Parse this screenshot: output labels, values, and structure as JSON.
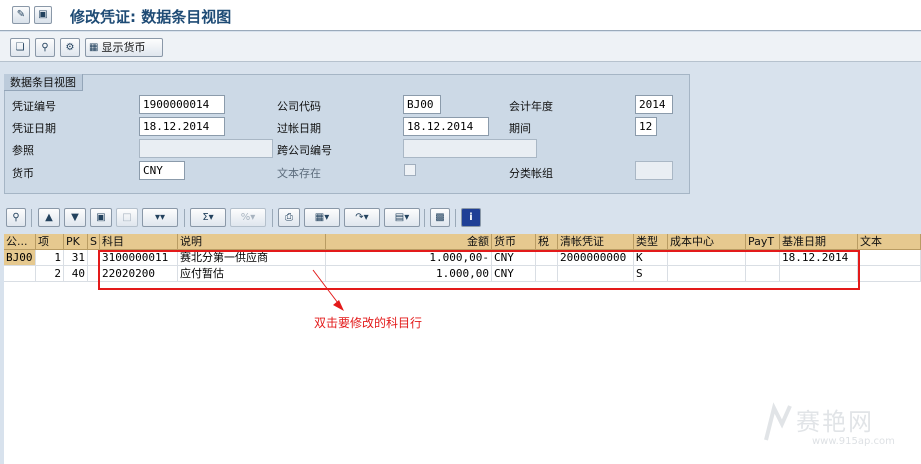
{
  "window": {
    "title": "修改凭证: 数据条目视图",
    "title_buttons": [
      "display-change-icon",
      "save-icon"
    ]
  },
  "app_toolbar": {
    "buttons": [
      "other-document-icon",
      "search-icon",
      "settings-icon"
    ],
    "display_currency_label": "显示货币"
  },
  "header": {
    "group_title": "数据条目视图",
    "fields": {
      "document_number": {
        "label": "凭证编号",
        "value": "1900000014"
      },
      "company_code": {
        "label": "公司代码",
        "value": "BJ00"
      },
      "fiscal_year": {
        "label": "会计年度",
        "value": "2014"
      },
      "document_date": {
        "label": "凭证日期",
        "value": "18.12.2014"
      },
      "posting_date": {
        "label": "过帐日期",
        "value": "18.12.2014"
      },
      "period": {
        "label": "期间",
        "value": "12"
      },
      "reference": {
        "label": "参照",
        "value": ""
      },
      "cross_company": {
        "label": "跨公司编号",
        "value": ""
      },
      "currency": {
        "label": "货币",
        "value": "CNY"
      },
      "text_exists": {
        "label": "文本存在",
        "checked": false
      },
      "ledger_group": {
        "label": "分类帐组",
        "value": ""
      }
    }
  },
  "grid_toolbar": {
    "icons": [
      "details-icon",
      "up-icon",
      "filter-icon",
      "find-icon",
      "select-icon",
      "funnel-icon",
      "sum-icon",
      "subtotal-icon",
      "percent-icon",
      "print-icon",
      "view-icon",
      "export-icon",
      "layout-icon",
      "graphic-icon",
      "info-icon"
    ]
  },
  "table": {
    "columns": [
      "公...",
      "项",
      "PK",
      "S",
      "科目",
      "说明",
      "金额",
      "货币",
      "税",
      "清帐凭证",
      "类型",
      "成本中心",
      "PayT",
      "基准日期",
      "文本"
    ],
    "rows": [
      {
        "company": "BJ00",
        "item": "1",
        "pk": "31",
        "s": "",
        "account": "3100000011",
        "description": "赛北分第一供应商",
        "amount": "1.000,00-",
        "currency": "CNY",
        "tax": "",
        "clearing": "2000000000",
        "type": "K",
        "cost_center": "",
        "payt": "",
        "baseline_date": "18.12.2014",
        "text": ""
      },
      {
        "company": "",
        "item": "2",
        "pk": "40",
        "s": "",
        "account": "22020200",
        "description": "应付暂估",
        "amount": "1.000,00",
        "currency": "CNY",
        "tax": "",
        "clearing": "",
        "type": "S",
        "cost_center": "",
        "payt": "",
        "baseline_date": "",
        "text": ""
      }
    ]
  },
  "annotation": {
    "text": "双击要修改的科目行",
    "color": "#e31a1a"
  },
  "watermark": {
    "name": "赛艳网",
    "url": "www.915ap.com"
  },
  "colors": {
    "background": "#d8e2ed",
    "title_text": "#1e4b75",
    "column_header": "#e6c98f",
    "annotation": "#e31a1a"
  }
}
